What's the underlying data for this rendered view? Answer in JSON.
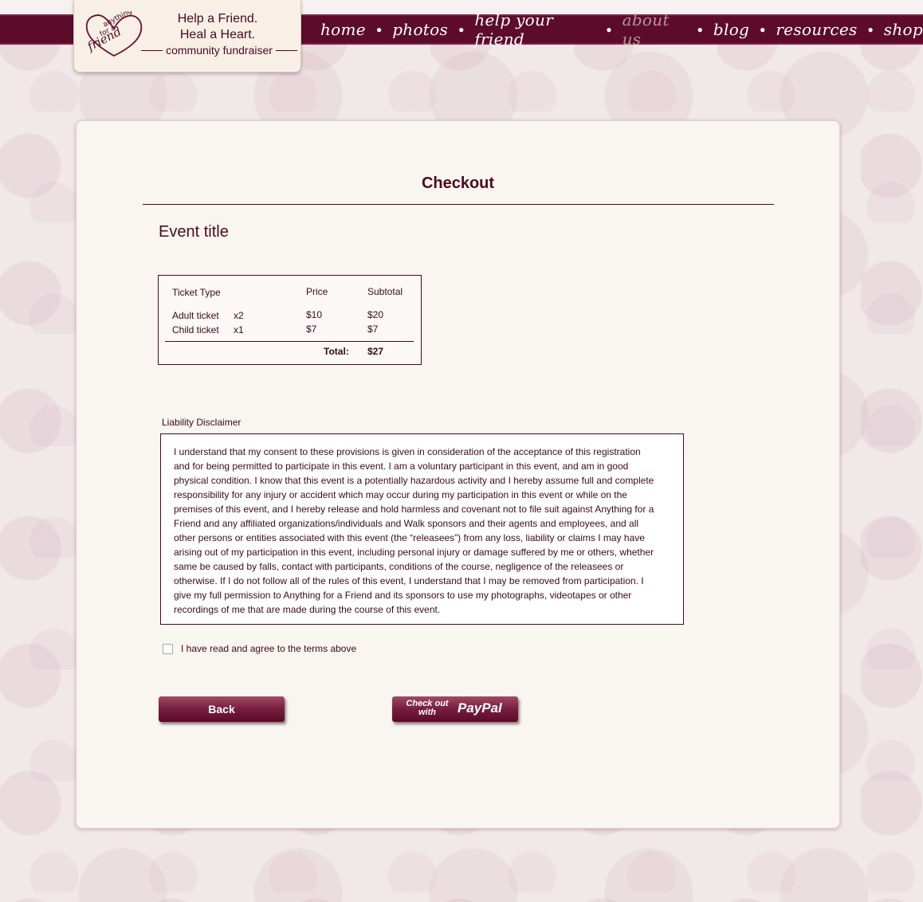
{
  "brand": {
    "logo_lines": [
      "anything",
      "for a",
      "friend"
    ],
    "tagline_1": "Help a Friend.",
    "tagline_2": "Heal a Heart.",
    "tagline_3": "community fundraiser"
  },
  "nav": {
    "items": [
      "home",
      "photos",
      "help your friend",
      "about us",
      "blog",
      "resources",
      "shop"
    ],
    "active": "about us"
  },
  "page": {
    "title": "Checkout",
    "event_title": "Event title"
  },
  "ticket_table": {
    "headers": {
      "type": "Ticket Type",
      "price": "Price",
      "subtotal": "Subtotal"
    },
    "rows": [
      {
        "type": "Adult ticket",
        "qty": "x2",
        "price": "$10",
        "subtotal": "$20"
      },
      {
        "type": "Child ticket",
        "qty": "x1",
        "price": "$7",
        "subtotal": "$7"
      }
    ],
    "total_label": "Total:",
    "total_value": "$27"
  },
  "disclaimer": {
    "label": "Liability Disclaimer",
    "lines": [
      "I understand that my consent to these provisions is given in consideration of the acceptance of this registration",
      "and for being permitted to participate in this event.  I am a voluntary participant in this event, and am in good",
      "physical condition.  I know that this event is a potentially hazardous activity and I hereby assume full and complete",
      "responsibility for any injury or accident which may occur during my participation in this event or while on the",
      "premises of this event, and I hereby release and hold harmless and covenant not to file suit against Anything for a",
      "Friend  and any affiliated organizations/individuals and Walk sponsors and their agents and employees, and all",
      "other persons or entities associated with this event (the “releasees”) from any loss, liability or claims I may have",
      "arising out of my participation in this event, including personal injury or damage suffered by me or others, whether",
      "same be caused by falls, contact with participants, conditions of the course, negligence of the releasees or",
      "otherwise.  If I do not follow all of the rules of this event, I understand that I may be removed from participation.  I",
      "give my full permission to Anything for a Friend and its sponsors to use my photographs, videotapes or other",
      "recordings of me that are made during the course of this event."
    ],
    "agree_label": "I have read and agree to the terms above",
    "agree_checked": false
  },
  "buttons": {
    "back": "Back",
    "paypal_small": "Check out with",
    "paypal_big": "PayPal"
  },
  "colors": {
    "brand": "#5c0c2a",
    "text": "#4a0a22",
    "panel": "#f9f5f0",
    "background": "#f1e8ea"
  }
}
